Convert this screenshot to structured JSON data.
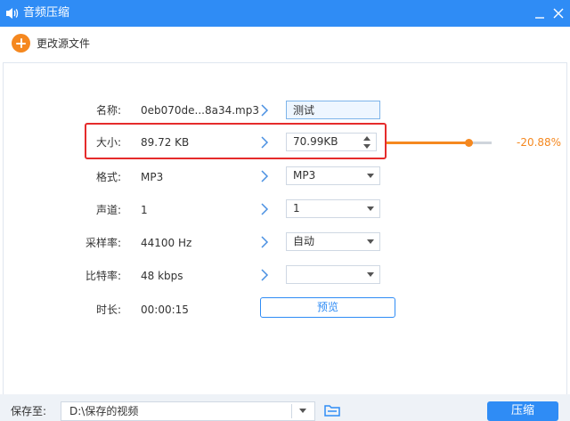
{
  "window": {
    "title": "音频压缩"
  },
  "toolbar": {
    "change_source_label": "更改源文件"
  },
  "rows": {
    "name": {
      "label": "名称:",
      "value": "0eb070de...8a34.mp3",
      "input": "测试"
    },
    "size": {
      "label": "大小:",
      "value": "89.72 KB",
      "target": "70.99KB",
      "percent": "-20.88%",
      "slider_fraction": 0.78
    },
    "format": {
      "label": "格式:",
      "value": "MP3",
      "select": "MP3"
    },
    "channel": {
      "label": "声道:",
      "value": "1",
      "select": "1"
    },
    "sample": {
      "label": "采样率:",
      "value": "44100 Hz",
      "select": "自动"
    },
    "bitrate": {
      "label": "比特率:",
      "value": "48 kbps",
      "select": ""
    },
    "duration": {
      "label": "时长:",
      "value": "00:00:15"
    }
  },
  "preview": {
    "label": "预览"
  },
  "footer": {
    "save_label": "保存至:",
    "path": "D:\\保存的视频",
    "compress_label": "压缩"
  },
  "colors": {
    "accent": "#2f8cf5",
    "orange": "#f5881f",
    "highlight": "#e52b2b"
  },
  "icons": {
    "app": "audio-icon",
    "add": "plus-circle-icon",
    "folder": "folder-icon"
  }
}
